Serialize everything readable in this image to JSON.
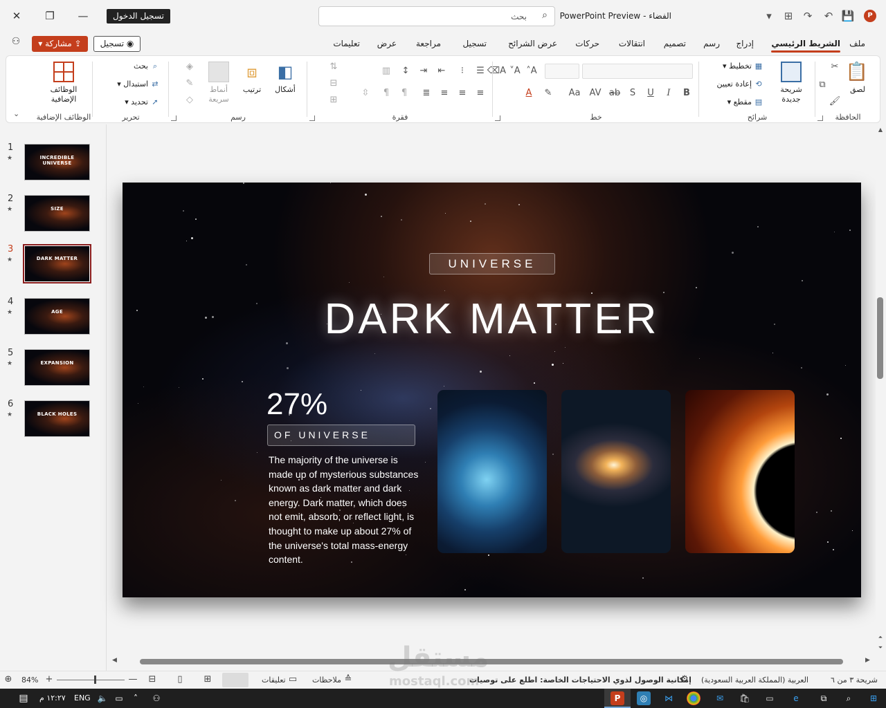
{
  "titlebar": {
    "doc_title": "الفضاء",
    "app_name": "PowerPoint Preview",
    "title_separator": "-",
    "search_placeholder": "بحث",
    "sign_in": "تسجيل الدخول",
    "app_icon_letter": "P"
  },
  "menu": {
    "tabs": [
      "ملف",
      "الشريط الرئيسي",
      "إدراج",
      "رسم",
      "تصميم",
      "انتقالات",
      "حركات",
      "عرض الشرائح",
      "تسجيل",
      "مراجعة",
      "عرض",
      "تعليمات"
    ],
    "active_tab": "الشريط الرئيسي",
    "record_button": "تسجيل",
    "share_button": "مشاركة"
  },
  "ribbon": {
    "clipboard": {
      "label": "الحافظة",
      "paste": "لصق"
    },
    "slides": {
      "label": "شرائح",
      "new_slide": "شريحة جديدة",
      "layout": "تخطيط",
      "reset": "إعادة تعيين",
      "section": "مقطع"
    },
    "font": {
      "label": "خط",
      "bold": "B",
      "italic": "I",
      "underline": "U",
      "strike": "ab",
      "shadow": "S",
      "spacing": "AV",
      "case": "Aa",
      "color": "A"
    },
    "paragraph": {
      "label": "فقرة"
    },
    "drawing": {
      "label": "رسم",
      "shapes": "أشكال",
      "arrange": "ترتيب",
      "quick_styles": "أنماط سريعة"
    },
    "editing": {
      "label": "تحرير",
      "find": "بحث",
      "replace": "استبدال",
      "select": "تحديد"
    },
    "addins": {
      "label": "الوظائف الإضافية",
      "button": "الوظائف الإضافية"
    }
  },
  "slide_panel": {
    "slides": [
      {
        "number": "1",
        "title": "INCREDIBLE UNIVERSE"
      },
      {
        "number": "2",
        "title": "SIZE"
      },
      {
        "number": "3",
        "title": "DARK MATTER"
      },
      {
        "number": "4",
        "title": "AGE"
      },
      {
        "number": "5",
        "title": "EXPANSION"
      },
      {
        "number": "6",
        "title": "BLACK HOLES"
      }
    ],
    "selected": 3,
    "transition_mark": "★"
  },
  "slide": {
    "eyebrow": "UNIVERSE",
    "title": "DARK MATTER",
    "stat_value": "27%",
    "stat_label": "OF UNIVERSE",
    "body": "The majority of the universe is made up of mysterious substances known as dark matter and dark energy. Dark matter, which does not emit, absorb, or reflect light, is thought to make up about 27% of the universe's total mass-energy content."
  },
  "status": {
    "slide_counter": "شريحة ٣ من ٦",
    "language": "العربية (المملكة العربية السعودية)",
    "accessibility": "إمكانية الوصول لذوي الاحتياجات الخاصة: اطلع على توصيات",
    "notes": "ملاحظات",
    "comments": "تعليقات",
    "zoom": "84%"
  },
  "taskbar": {
    "time": "١٢:٢٧ م",
    "language": "ENG"
  },
  "watermark": {
    "arabic": "مستقل",
    "latin": "mostaql.com"
  },
  "colors": {
    "accent": "#c43e1c",
    "selected_thumb_border": "#8a1c1c",
    "ribbon_bg": "#ffffff"
  }
}
